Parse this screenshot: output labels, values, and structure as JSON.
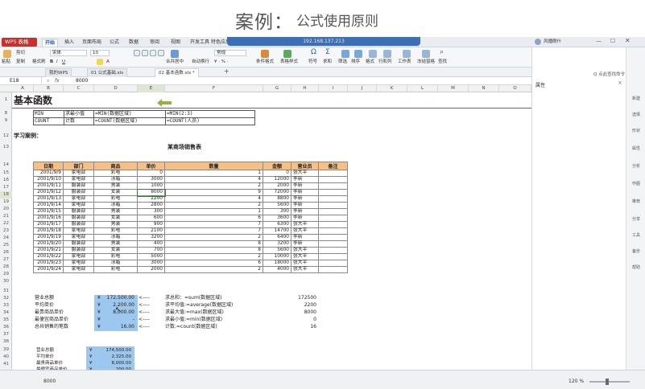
{
  "banner": {
    "title": "案例：",
    "subtitle": "公式使用原则"
  },
  "app": {
    "logo": "WPS 表格",
    "remote_ip": "192.168.137.213",
    "user": "风播刚什"
  },
  "menu_tabs": [
    "开始",
    "插入",
    "页面布局",
    "公式",
    "数据",
    "审阅",
    "视图",
    "开发工具",
    "特色应用"
  ],
  "ribbon": {
    "paste": "粘贴",
    "cut": "剪切",
    "copy": "复制",
    "format_painter": "格式刷",
    "font": "宋体",
    "size": "10",
    "number_format": "常规",
    "merge": "合并居中",
    "wrap": "自动换行",
    "cond_format": "条件格式",
    "table_style": "表格样式",
    "symbol": "符号",
    "sum": "求和",
    "filter": "筛选",
    "sort": "排序",
    "fmt": "格式",
    "rowcol": "行和列",
    "sheet": "工作表",
    "freeze": "冻结窗格",
    "find": "查找"
  },
  "doc_tabs": [
    "我的WPS",
    "01 公式基础.xls",
    "02 基本函数.xls *"
  ],
  "formula_bar": {
    "cell": "E18",
    "fx": "fx",
    "value": "8000"
  },
  "columns": [
    "A",
    "B",
    "C",
    "D",
    "E",
    "F",
    "G",
    "H",
    "I",
    "J",
    "K",
    "L",
    "M",
    "N",
    "O"
  ],
  "rows": [
    "1",
    "8",
    "9",
    "12",
    "13",
    "14",
    "15",
    "16",
    "17",
    "18",
    "19",
    "20",
    "21",
    "22",
    "23",
    "24",
    "25",
    "26",
    "27",
    "28",
    "29",
    "30",
    "31",
    "32",
    "33",
    "34",
    "35",
    "36",
    "37",
    "38",
    "39",
    "40",
    "41",
    "42"
  ],
  "sheet": {
    "title": "基本函数",
    "r8": [
      "MIN",
      "求最小值",
      "=MIN(数据区域)",
      "=MIN(2:3)"
    ],
    "r9": [
      "COUNT",
      "计数",
      "=COUNT(数据区域)",
      "=COUNT(人员)"
    ],
    "study": "学习案例：",
    "table_title": "某商场销售表",
    "headers": [
      "日期",
      "部门",
      "商品",
      "单价",
      "数量",
      "金额",
      "营业员",
      "备注"
    ],
    "data": [
      [
        "2001/9/9",
        "家电部",
        "彩电",
        "0",
        "1",
        "0",
        "张大平"
      ],
      [
        "2001/9/10",
        "家电部",
        "冰箱",
        "3000",
        "4",
        "12000",
        "李新"
      ],
      [
        "2001/9/11",
        "服装部",
        "男装",
        "1000",
        "2",
        "2000",
        "李新"
      ],
      [
        "2001/9/12",
        "服装部",
        "女装",
        "8000",
        "9",
        "72000",
        "李新"
      ],
      [
        "2001/9/13",
        "家电部",
        "彩电",
        "2200",
        "4",
        "8800",
        "李新"
      ],
      [
        "2001/9/14",
        "家电部",
        "冰箱",
        "2800",
        "2",
        "5600",
        "李新"
      ],
      [
        "2001/9/15",
        "服装部",
        "男装",
        "300",
        "1",
        "300",
        "李新"
      ],
      [
        "2001/9/16",
        "服装部",
        "女装",
        "600",
        "6",
        "3600",
        "李新"
      ],
      [
        "2001/9/17",
        "服装部",
        "男装",
        "900",
        "7",
        "6300",
        "张大平"
      ],
      [
        "2001/9/18",
        "家电部",
        "彩电",
        "2100",
        "7",
        "14700",
        "张大平"
      ],
      [
        "2001/9/19",
        "家电部",
        "冰箱",
        "3200",
        "2",
        "6400",
        "李新"
      ],
      [
        "2001/9/20",
        "服装部",
        "男装",
        "400",
        "8",
        "3200",
        "李新"
      ],
      [
        "2001/9/21",
        "服装部",
        "女装",
        "700",
        "8",
        "5600",
        "张大平"
      ],
      [
        "2001/9/22",
        "家电部",
        "彩电",
        "5000",
        "2",
        "10000",
        "张大平"
      ],
      [
        "2001/9/23",
        "家电部",
        "冰箱",
        "3000",
        "6",
        "18000",
        "张大平"
      ],
      [
        "2001/9/24",
        "家电部",
        "彩电",
        "2000",
        "2",
        "4000",
        "张大平"
      ]
    ],
    "summary": [
      {
        "label": "营业总额",
        "cur": "¥",
        "value": "172,500.00",
        "arrow": "<----",
        "desc": "求总和：=sum(数据区域)",
        "result": "172500"
      },
      {
        "label": "平均单价",
        "cur": "¥",
        "value": "2,200.00",
        "arrow": "<----",
        "desc": "求平均值:=average(数据区域)",
        "result": "2200"
      },
      {
        "label": "最贵商品单价",
        "cur": "¥",
        "value": "8,000.00",
        "arrow": "<----",
        "desc": "求最大值:=max(数据区域)",
        "result": "8000"
      },
      {
        "label": "最便宜商品单价",
        "cur": "¥",
        "value": "-",
        "arrow": "<----",
        "desc": "求最小值:=min(数据区域)",
        "result": "0"
      },
      {
        "label": "总共销售的笔数",
        "cur": "¥",
        "value": "16.00",
        "arrow": "<----",
        "desc": "计数:=count(数据区域)",
        "result": "16"
      }
    ],
    "summary2": [
      {
        "label": "营业总额",
        "cur": "¥",
        "value": "174,500.00"
      },
      {
        "label": "平均单价",
        "cur": "¥",
        "value": "2,325.00"
      },
      {
        "label": "最贵商品单价",
        "cur": "¥",
        "value": "8,000.00"
      },
      {
        "label": "最便宜商品单价",
        "cur": "¥",
        "value": "200.00"
      }
    ]
  },
  "right_panel": {
    "title": "属性",
    "items": [
      "新建",
      "选择",
      "形状",
      "属性",
      "分析",
      "作图",
      "推荐",
      "分享",
      "工具",
      "备份",
      "帮助"
    ]
  },
  "status": {
    "cell_value": "8000",
    "zoom": "120 %"
  }
}
